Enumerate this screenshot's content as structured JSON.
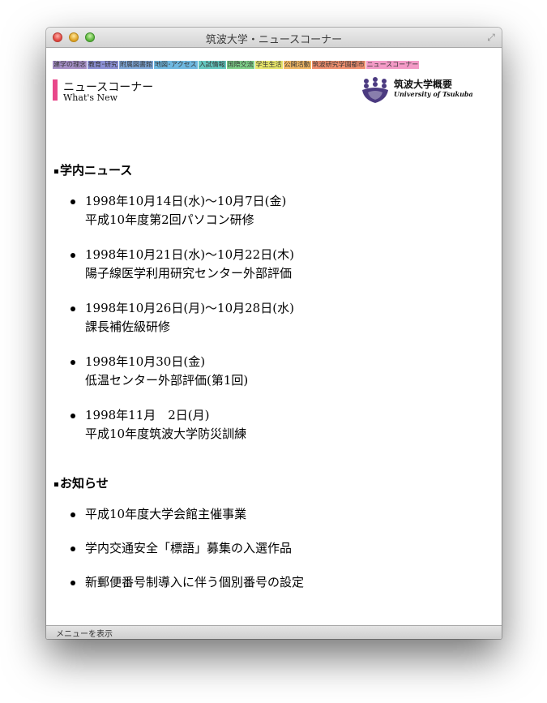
{
  "window": {
    "title": "筑波大学・ニュースコーナー"
  },
  "nav": [
    {
      "label": "建学の理念",
      "color": "#a58fc7"
    },
    {
      "label": "教育･研究",
      "color": "#8a8fd4"
    },
    {
      "label": "附属図書館",
      "color": "#7ea7d8"
    },
    {
      "label": "地図･アクセス",
      "color": "#6fb8e0"
    },
    {
      "label": "入試情報",
      "color": "#64c7c0"
    },
    {
      "label": "国際交流",
      "color": "#7fd08a"
    },
    {
      "label": "学生生活",
      "color": "#e6e46a"
    },
    {
      "label": "公開活動",
      "color": "#f0b764"
    },
    {
      "label": "筑波研究学園都市",
      "color": "#ef8f6f"
    },
    {
      "label": "ニュースコーナー",
      "color": "#f39ac6"
    }
  ],
  "header": {
    "title": "ニュースコーナー",
    "subtitle": "What's New",
    "accent": "#e8488a"
  },
  "logo": {
    "name": "筑波大学概要",
    "sub": "University of Tsukuba"
  },
  "sections": {
    "campus_news": {
      "heading": "学内ニュース",
      "items": [
        {
          "date": "1998年10月14日(水)〜10月7日(金)",
          "title": "平成10年度第2回パソコン研修"
        },
        {
          "date": "1998年10月21日(水)〜10月22日(木)",
          "title": "陽子線医学利用研究センター外部評価"
        },
        {
          "date": "1998年10月26日(月)〜10月28日(水)",
          "title": "課長補佐級研修"
        },
        {
          "date": "1998年10月30日(金)",
          "title": "低温センター外部評価(第1回)"
        },
        {
          "date": "1998年11月　2日(月)",
          "title": "平成10年度筑波大学防災訓練"
        }
      ]
    },
    "notices": {
      "heading": "お知らせ",
      "items": [
        {
          "title": "平成10年度大学会館主催事業"
        },
        {
          "title": "学内交通安全「標語」募集の入選作品"
        },
        {
          "title": "新郵便番号制導入に伴う個別番号の設定"
        }
      ]
    }
  },
  "statusbar": {
    "text": "メニューを表示"
  }
}
